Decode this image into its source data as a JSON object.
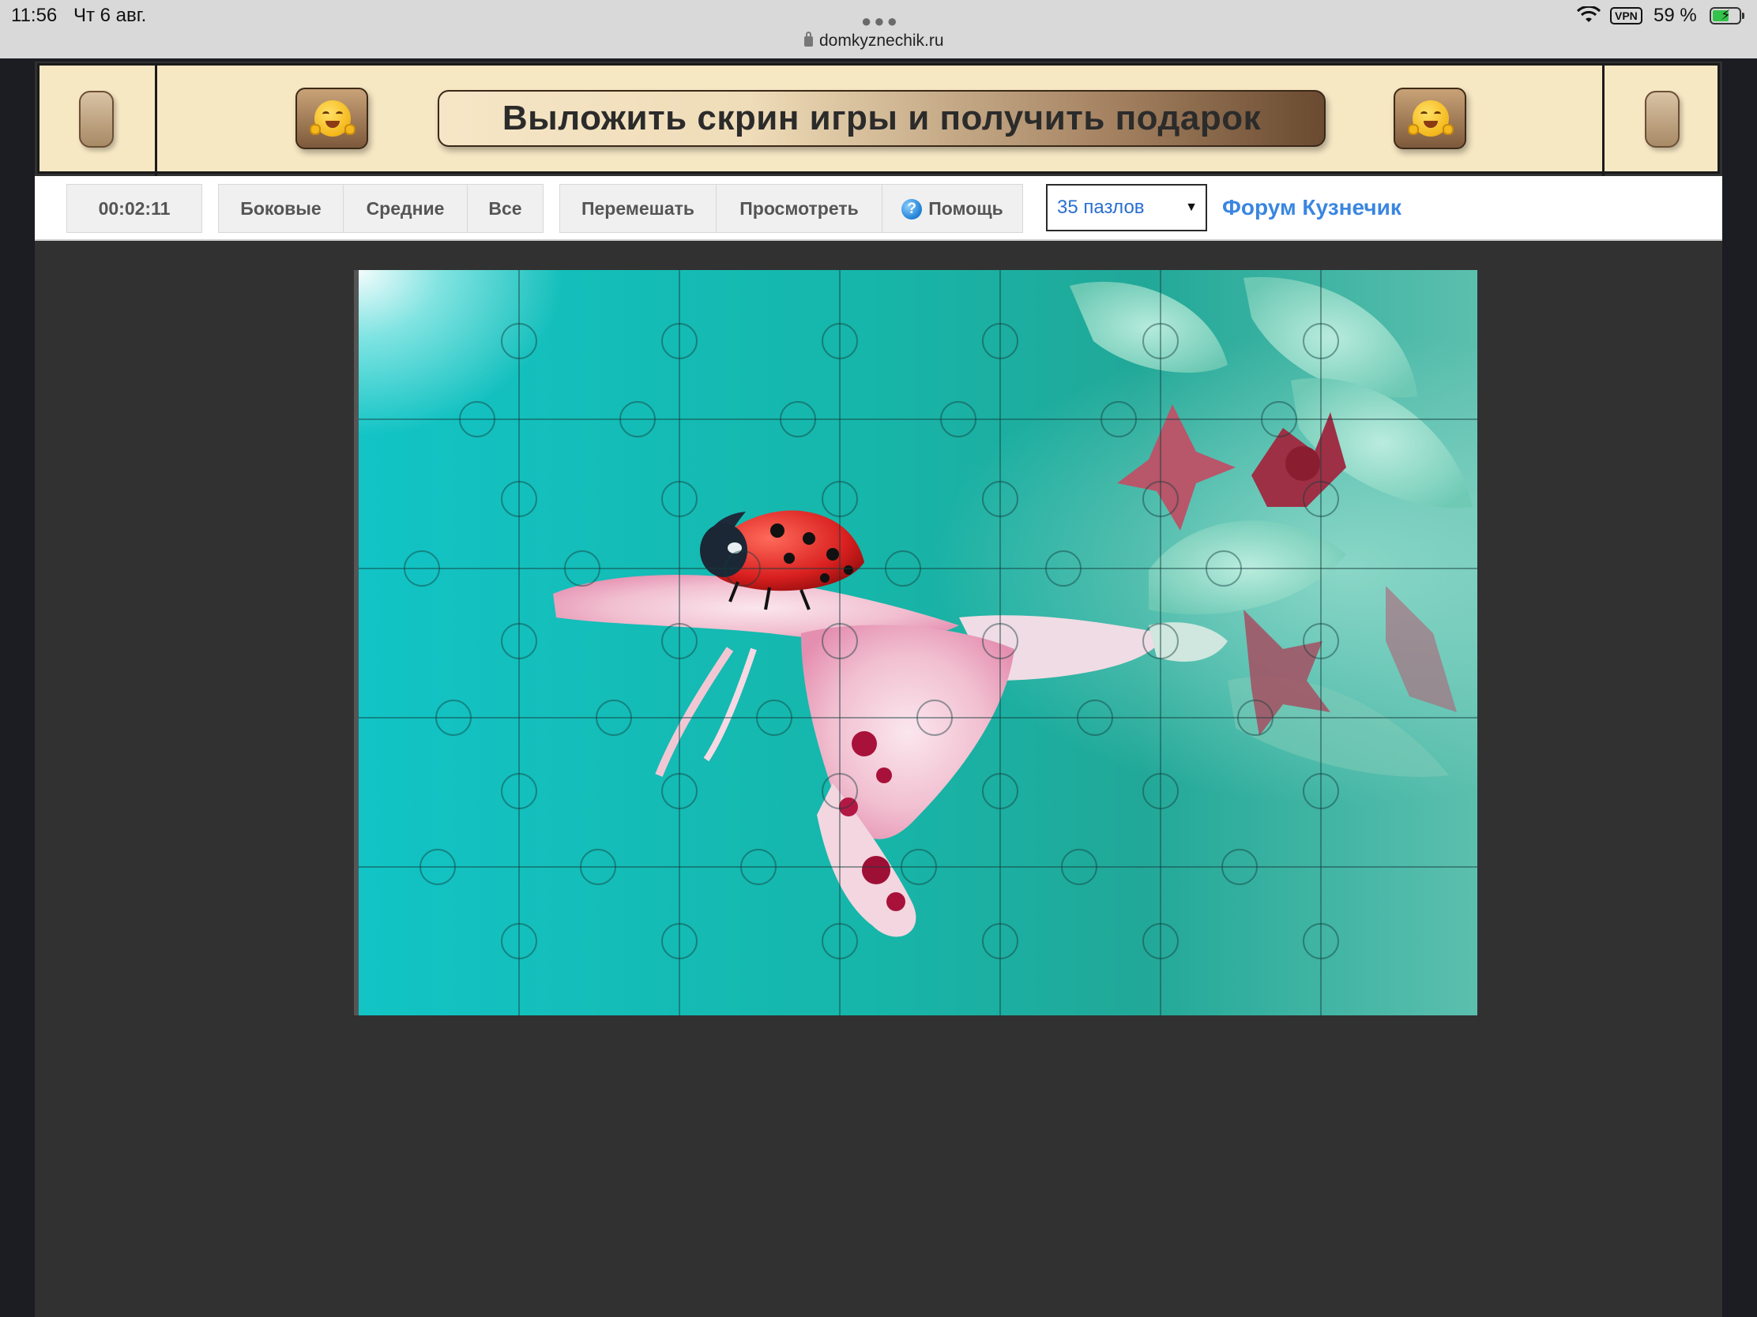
{
  "status_bar": {
    "time": "11:56",
    "date": "Чт 6 авг.",
    "url": "domkyznechik.ru",
    "vpn": "VPN",
    "battery": "59 %"
  },
  "banner": {
    "promo_label": "Выложить скрин игры и получить подарок",
    "emoji": "hugging-face"
  },
  "toolbar": {
    "timer": "00:02:11",
    "filter_buttons": [
      "Боковые",
      "Средние",
      "Все"
    ],
    "action_buttons": [
      "Перемешать",
      "Просмотреть"
    ],
    "help_label": "Помощь",
    "pieces_select": "35 пазлов",
    "forum_link": "Форум Кузнечик"
  },
  "puzzle": {
    "columns": 7,
    "rows": 5,
    "subject": "ladybug on a pink flower, teal background"
  },
  "colors": {
    "banner_bg": "#f7e8c4",
    "page_bg": "#313131",
    "link": "#3a86e0",
    "ladybug": "#e02a2a",
    "teal": "#16b6aa"
  }
}
